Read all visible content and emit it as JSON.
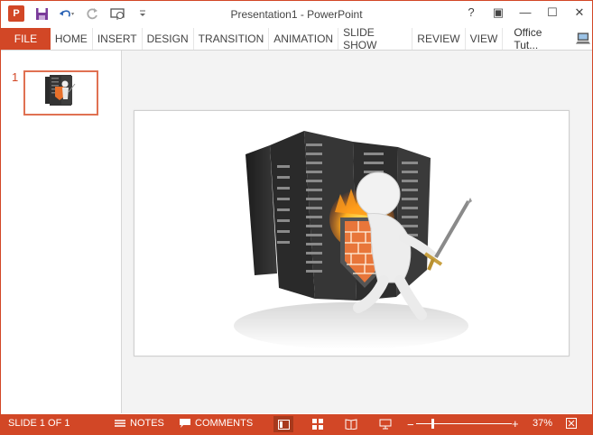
{
  "window": {
    "title": "Presentation1 - PowerPoint",
    "app_icon": "P",
    "accent": "#d24726"
  },
  "qat": {
    "icons": [
      "powerpoint-icon",
      "save-icon",
      "undo-icon",
      "redo-icon",
      "slideshow-from-start-icon",
      "customize-qat-icon"
    ]
  },
  "window_controls": {
    "help": "?",
    "ribbon_display": "▣",
    "minimize": "—",
    "maximize": "☐",
    "close": "✕"
  },
  "ribbon": {
    "file": "FILE",
    "tabs": [
      "HOME",
      "INSERT",
      "DESIGN",
      "TRANSITION",
      "ANIMATION",
      "SLIDE SHOW",
      "REVIEW",
      "VIEW"
    ],
    "account": "Office Tut..."
  },
  "thumbnails": {
    "items": [
      {
        "number": "1"
      }
    ]
  },
  "status": {
    "slide": "SLIDE 1 OF 1",
    "notes": "NOTES",
    "comments": "COMMENTS",
    "zoom": "37%",
    "zoom_minus": "−",
    "zoom_plus": "+",
    "zoom_fraction": 0.37
  }
}
